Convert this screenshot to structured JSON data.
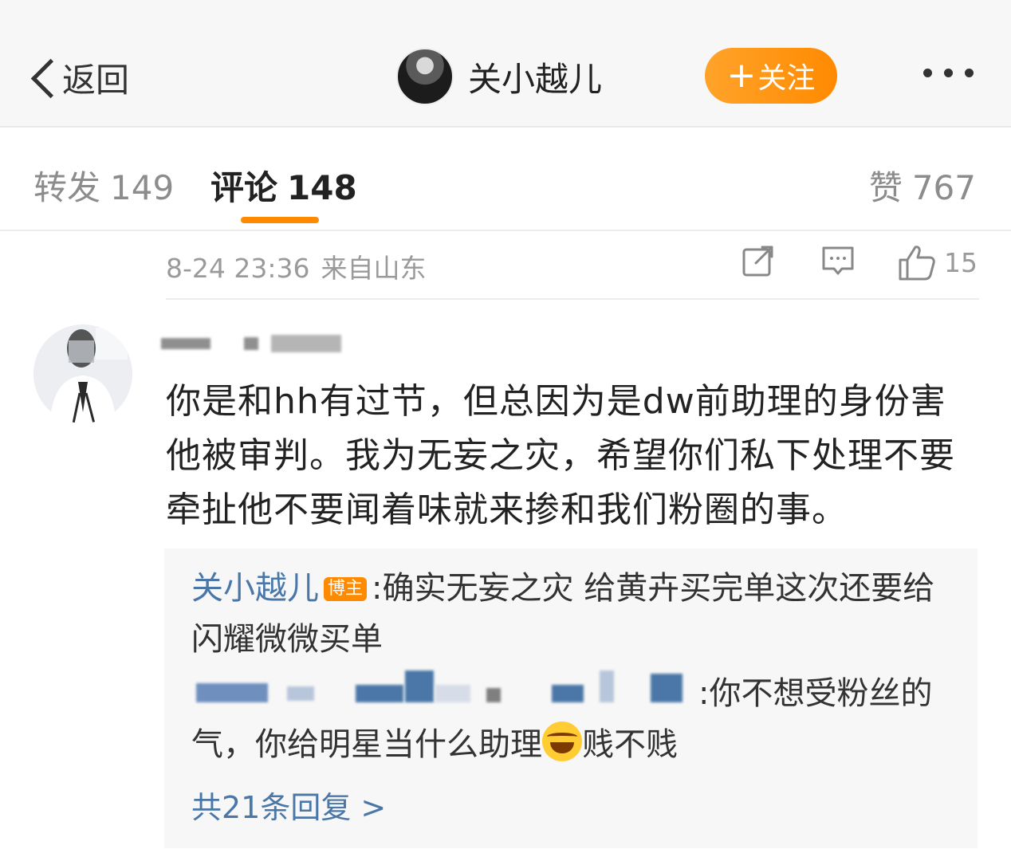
{
  "nav": {
    "back_label": "返回",
    "author_name": "关小越儿",
    "follow_label": "关注",
    "follow_plus": "+"
  },
  "tabs": {
    "repost_label": "转发",
    "repost_count": "149",
    "comments_label": "评论",
    "comments_count": "148",
    "likes_label": "赞",
    "likes_count": "767",
    "active": "comments"
  },
  "post_meta": {
    "timestamp": "8-24 23:36",
    "source": "来自山东",
    "like_count": "15"
  },
  "comment": {
    "text": "你是和hh有过节，但总因为是dw前助理的身份害他被审判。我为无妄之灾，希望你们私下处理不要牵扯他不要闻着味就来掺和我们粉圈的事。",
    "replies": [
      {
        "author": "关小越儿",
        "badge": "博主",
        "text": ":确实无妄之灾 给黄卉买完单这次还要给闪耀微微买单"
      },
      {
        "text_before_emoji": ":你不想受粉丝的气，你给明星当什么助理",
        "text_after_emoji": "贱不贱"
      }
    ],
    "more_replies": "共21条回复 >"
  },
  "colors": {
    "accent_orange": "#ff8a00",
    "link_blue": "#4a77a8",
    "muted_gray": "#9a9a9a"
  },
  "icons": [
    "back-chevron-icon",
    "more-dots-icon",
    "share-icon",
    "comment-icon",
    "like-thumb-icon",
    "laugh-cry-emoji-icon"
  ]
}
